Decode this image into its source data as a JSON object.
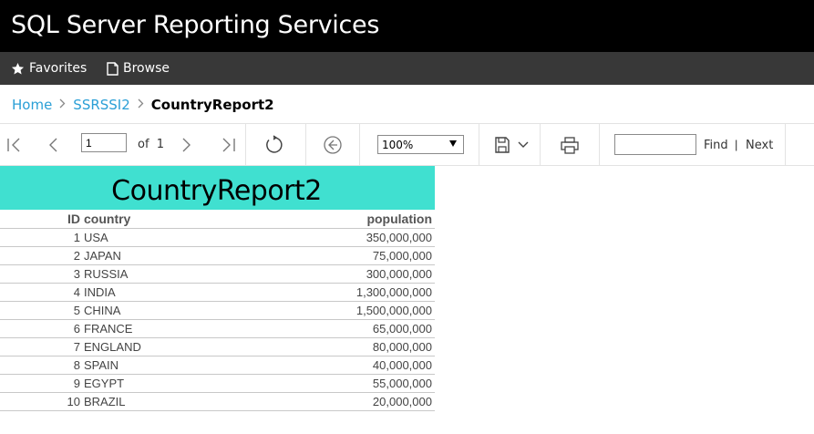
{
  "app": {
    "title": "SQL Server Reporting Services"
  },
  "nav": {
    "favorites_label": "Favorites",
    "favorites_icon": "star-icon",
    "browse_label": "Browse",
    "browse_icon": "document-icon"
  },
  "breadcrumb": {
    "home": "Home",
    "folder": "SSRSSI2",
    "current": "CountryReport2"
  },
  "toolbar": {
    "page_value": "1",
    "of_text": "of",
    "total_pages": "1",
    "zoom_value": "100%",
    "find_value": "",
    "find_label": "Find",
    "find_separator": "|",
    "next_label": "Next",
    "icons": [
      "first-page-icon",
      "previous-page-icon",
      "next-page-icon",
      "last-page-icon",
      "refresh-icon",
      "back-icon",
      "save-icon",
      "print-icon"
    ]
  },
  "report": {
    "title": "CountryReport2",
    "header_color": "#40e0d0",
    "columns": {
      "id": "ID",
      "country": "country",
      "population": "population"
    },
    "rows": [
      {
        "id": "1",
        "country": "USA",
        "population": "350,000,000"
      },
      {
        "id": "2",
        "country": "JAPAN",
        "population": "75,000,000"
      },
      {
        "id": "3",
        "country": "RUSSIA",
        "population": "300,000,000"
      },
      {
        "id": "4",
        "country": "INDIA",
        "population": "1,300,000,000"
      },
      {
        "id": "5",
        "country": "CHINA",
        "population": "1,500,000,000"
      },
      {
        "id": "6",
        "country": "FRANCE",
        "population": "65,000,000"
      },
      {
        "id": "7",
        "country": "ENGLAND",
        "population": "80,000,000"
      },
      {
        "id": "8",
        "country": "SPAIN",
        "population": "40,000,000"
      },
      {
        "id": "9",
        "country": "EGYPT",
        "population": "55,000,000"
      },
      {
        "id": "10",
        "country": "BRAZIL",
        "population": "20,000,000"
      }
    ]
  },
  "colors": {
    "titlebar": "#000000",
    "navbar": "#383838",
    "link": "#2a9fd6"
  }
}
